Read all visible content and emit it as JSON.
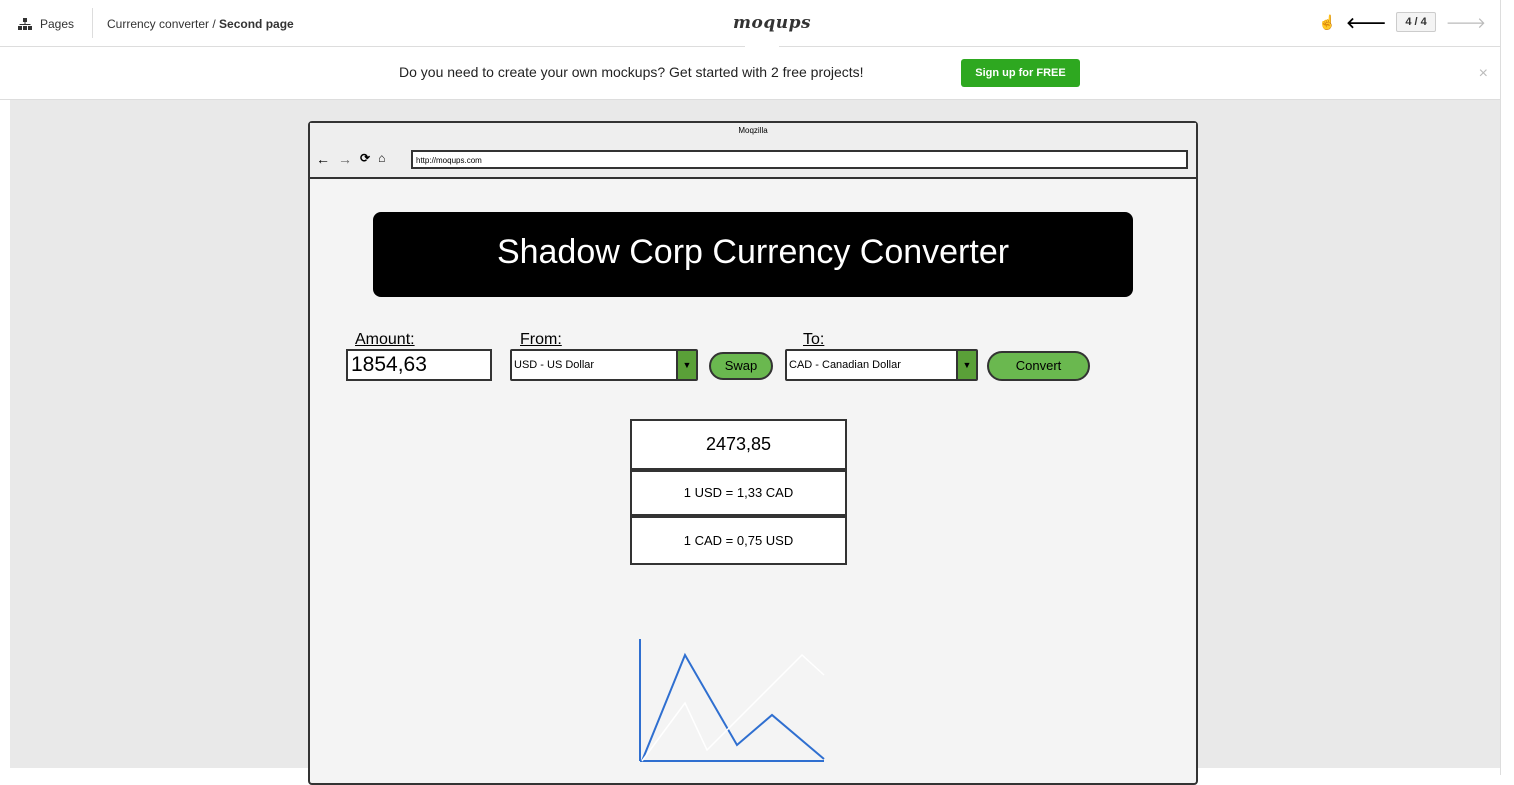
{
  "toolbar": {
    "pages_label": "Pages",
    "breadcrumb_prefix": "Currency converter / ",
    "breadcrumb_current": "Second page",
    "logo": "moqups",
    "more": "...",
    "page_counter": "4 / 4"
  },
  "banner": {
    "text": "Do you need to create your own mockups? Get started with 2 free projects!",
    "cta": "Sign up for FREE",
    "close": "×"
  },
  "browser": {
    "title": "Moqzilla",
    "url": "http://moqups.com"
  },
  "app": {
    "header": "Shadow Corp Currency Converter",
    "amount_label": "Amount:",
    "amount_value": "1854,63",
    "from_label": "From:",
    "from_value": "USD - US Dollar",
    "swap_label": "Swap",
    "to_label": "To:",
    "to_value": "CAD - Canadian Dollar",
    "convert_label": "Convert",
    "result": "2473,85",
    "rate_1": "1 USD = 1,33 CAD",
    "rate_2": "1 CAD = 0,75 USD"
  },
  "colors": {
    "accent_green": "#6ab84f",
    "signup_green": "#2ea820",
    "chart_blue": "#2f6fd0",
    "chart_white": "#ffffff"
  },
  "icons": [
    "sitemap-icon",
    "touch-icon",
    "arrow-left-icon",
    "arrow-right-icon",
    "close-icon",
    "back-icon",
    "forward-icon",
    "reload-icon",
    "home-icon",
    "dropdown-arrow-icon"
  ]
}
